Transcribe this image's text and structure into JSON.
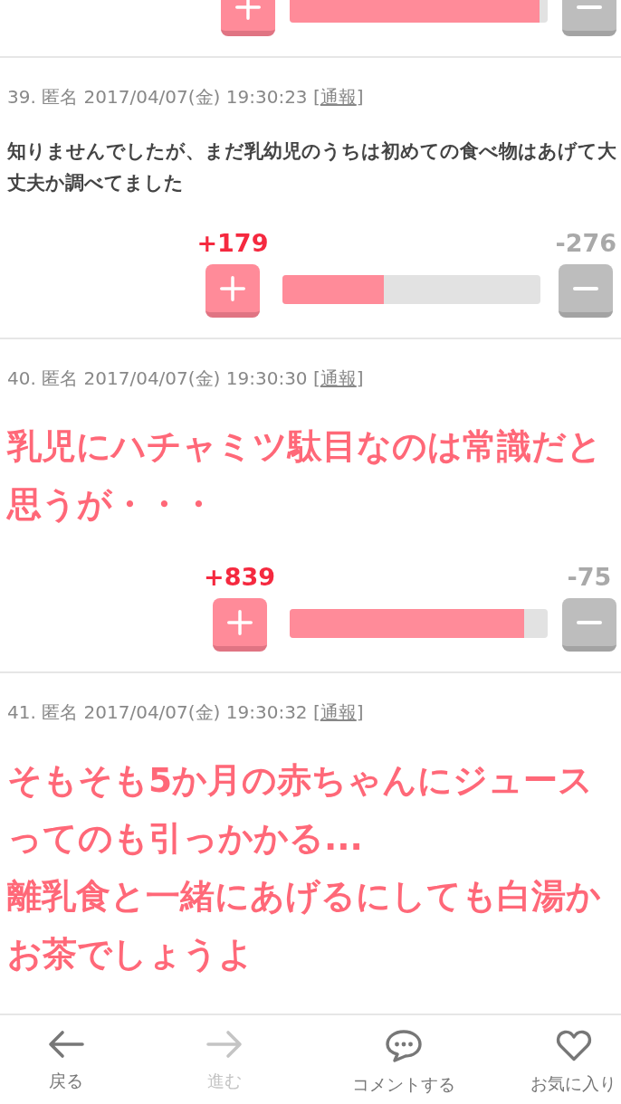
{
  "top_partial_votes": {
    "level": 0.97
  },
  "comments": [
    {
      "meta": "39. 匿名 2017/04/07(金) 19:30:23 [",
      "report_link": "通報",
      "meta_end": "]",
      "kind": "plain",
      "body": "知りませんでしたが、まだ乳幼児のうちは初めての食べ物はあげて大丈夫か調べてました",
      "plus_count": "+179",
      "minus_count": "-276",
      "level": 0.39
    },
    {
      "meta": "40. 匿名 2017/04/07(金) 19:30:30 [",
      "report_link": "通報",
      "meta_end": "]",
      "kind": "large",
      "body": "乳児にハチャミツ駄目なのは常識だと思うが・・・",
      "plus_count": "+839",
      "minus_count": "-75",
      "level": 0.91
    },
    {
      "meta": "41. 匿名 2017/04/07(金) 19:30:32 [",
      "report_link": "通報",
      "meta_end": "]",
      "kind": "large",
      "body": "そもそも5か月の赤ちゃんにジュースってのも引っかかる...\n離乳食と一緒にあげるにしても白湯かお茶でしょうよ"
    }
  ],
  "bottom_nav": [
    {
      "label": "戻る",
      "kind": "back",
      "disabled": false
    },
    {
      "label": "進む",
      "kind": "forward",
      "disabled": true
    },
    {
      "label": "コメントする",
      "kind": "comment",
      "disabled": false
    },
    {
      "label": "お気に入り",
      "kind": "favorite",
      "disabled": false
    }
  ]
}
